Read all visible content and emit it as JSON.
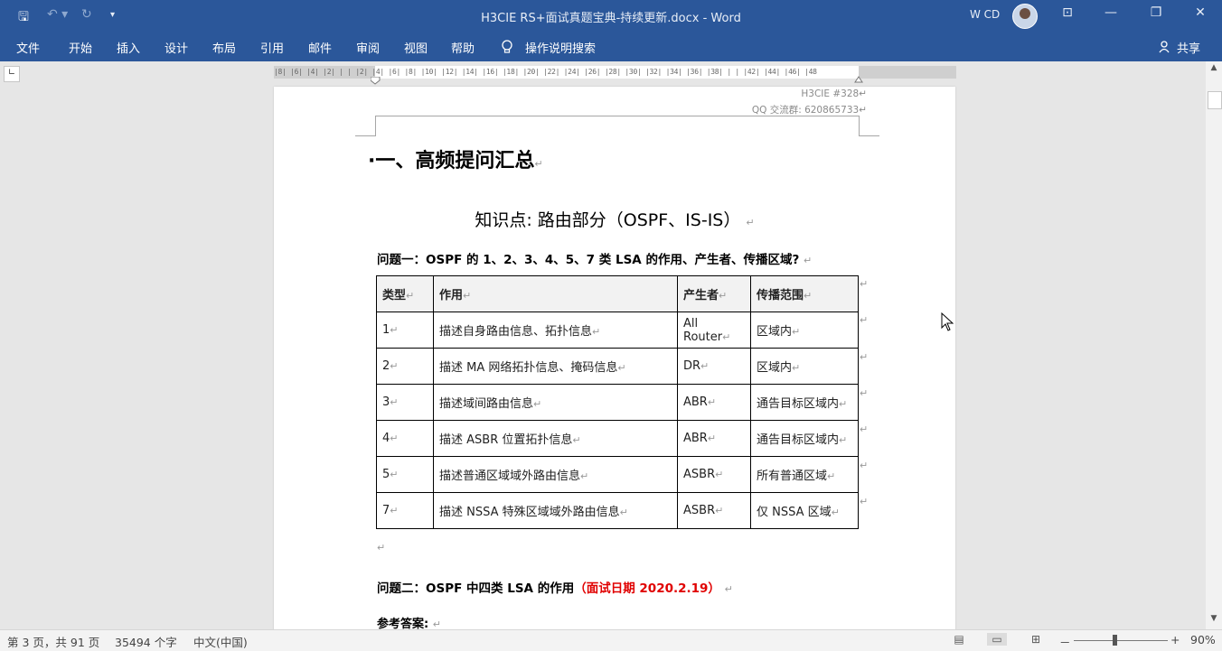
{
  "window": {
    "title": "H3CIE RS+面试真题宝典-持续更新.docx  -  Word",
    "user_name": "W CD",
    "quick_access": {
      "save": "🖫",
      "undo": "↶ ▾",
      "redo": "↻",
      "customize": "▾"
    },
    "controls": {
      "ribbon_display": "⊡",
      "minimize": "—",
      "restore": "❐",
      "close": "✕"
    }
  },
  "ribbon": {
    "tabs": [
      "文件",
      "开始",
      "插入",
      "设计",
      "布局",
      "引用",
      "邮件",
      "审阅",
      "视图",
      "帮助"
    ],
    "tell_me": "操作说明搜索",
    "share": "共享"
  },
  "ruler": {
    "marks": "|8| |6| |4| |2| |  |  |2| |4| |6| |8| |10| |12| |14| |16| |18| |20| |22| |24| |26| |28| |30| |32| |34| |36| |38| |  |  |42| |44| |46| |48"
  },
  "document": {
    "header_line1": "H3CIE  #328↵",
    "header_line2": "QQ 交流群:  620865733↵",
    "heading1": "·一、高频提问汇总",
    "heading2": "知识点:  路由部分（OSPF、IS-IS）",
    "paragraph_mark": "↵",
    "question1": "问题一：OSPF 的 1、2、3、4、5、7 类 LSA 的作用、产生者、传播区域?",
    "table": {
      "headers": [
        "类型",
        "作用",
        "产生者",
        "传播范围"
      ],
      "rows": [
        [
          "1",
          "描述自身路由信息、拓扑信息",
          "All Router",
          "区域内"
        ],
        [
          "2",
          "描述 MA 网络拓扑信息、掩码信息",
          "DR",
          "区域内"
        ],
        [
          "3",
          "描述域间路由信息",
          "ABR",
          "通告目标区域内"
        ],
        [
          "4",
          "描述 ASBR 位置拓扑信息",
          "ABR",
          "通告目标区域内"
        ],
        [
          "5",
          "描述普通区域域外路由信息",
          "ASBR",
          "所有普通区域"
        ],
        [
          "7",
          "描述 NSSA 特殊区域域外路由信息",
          "ASBR",
          "仅 NSSA 区域"
        ]
      ]
    },
    "question2": "问题二：OSPF 中四类 LSA 的作用",
    "question2_date": "（面试日期  2020.2.19）",
    "answer_label": "参考答案:"
  },
  "status": {
    "page": "第 3 页，共 91 页",
    "words": "35494 个字",
    "language": "中文(中国)",
    "zoom_minus": "－",
    "zoom_plus": "+",
    "zoom": "90%"
  }
}
